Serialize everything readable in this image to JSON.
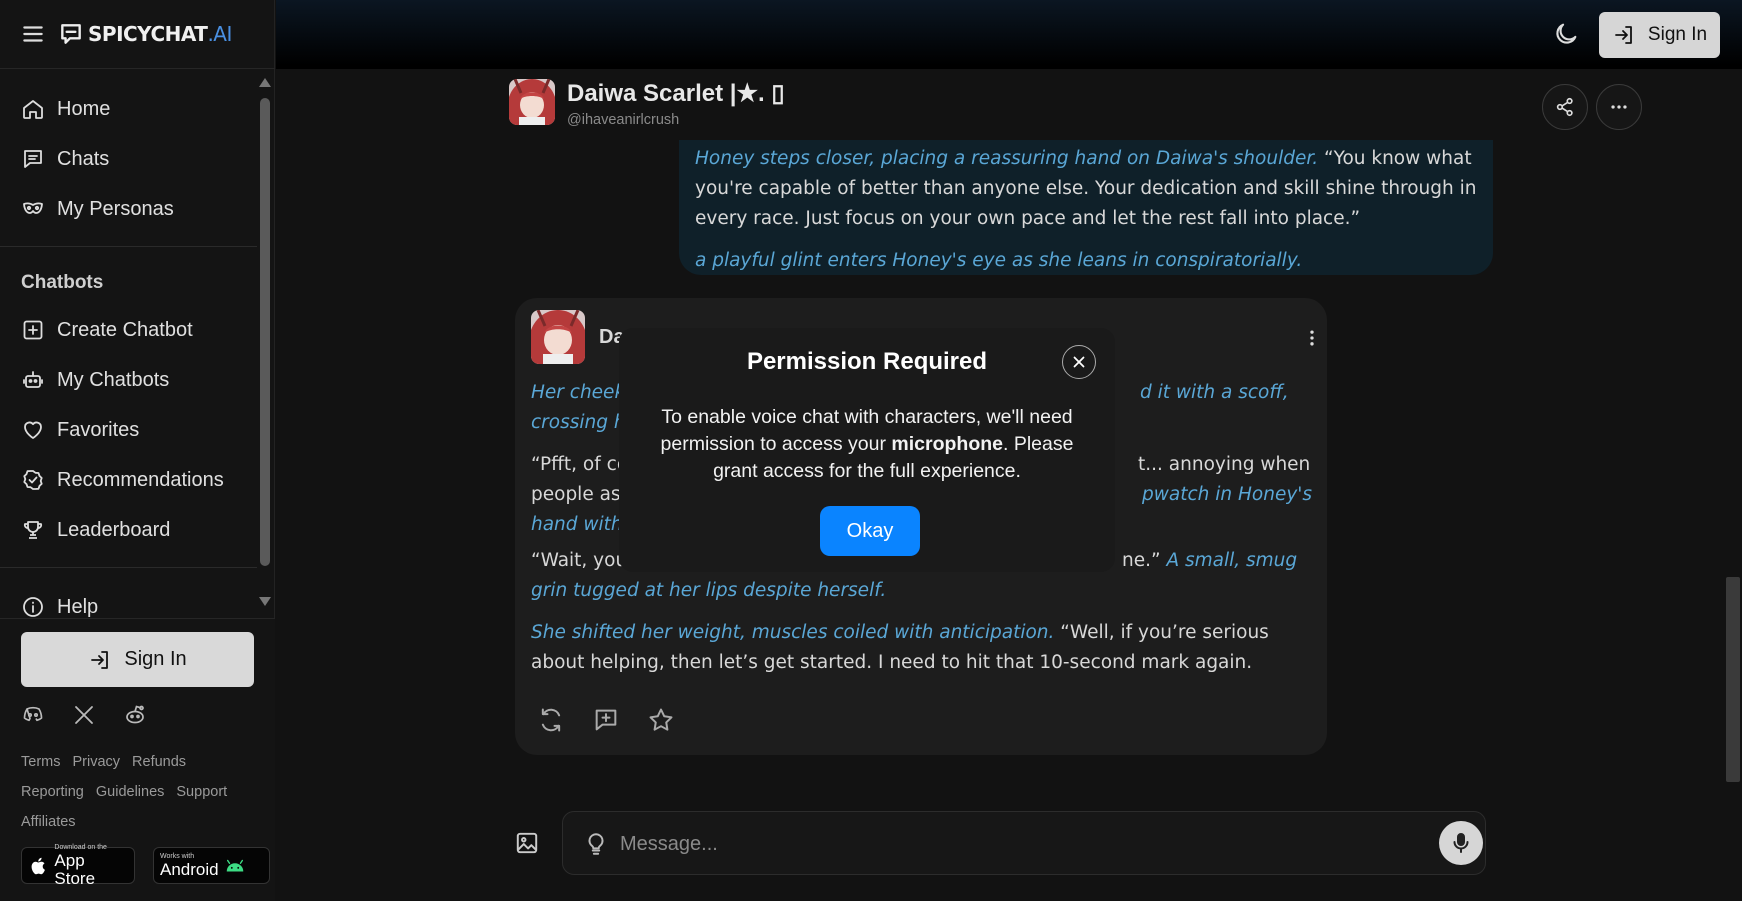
{
  "brand": {
    "name": "SPICYCHAT",
    "suffix": ".AI"
  },
  "sidebar": {
    "nav": [
      {
        "label": "Home",
        "icon": "home-icon"
      },
      {
        "label": "Chats",
        "icon": "chat-icon"
      },
      {
        "label": "My Personas",
        "icon": "mask-icon"
      }
    ],
    "section_heading": "Chatbots",
    "chatbots": [
      {
        "label": "Create Chatbot",
        "icon": "plus-square-icon"
      },
      {
        "label": "My Chatbots",
        "icon": "robot-icon"
      },
      {
        "label": "Favorites",
        "icon": "heart-icon"
      },
      {
        "label": "Recommendations",
        "icon": "check-badge-icon"
      },
      {
        "label": "Leaderboard",
        "icon": "trophy-icon"
      },
      {
        "label": "Help",
        "icon": "info-icon"
      }
    ],
    "sign_in": "Sign In",
    "links": [
      "Terms",
      "Privacy",
      "Refunds",
      "Reporting",
      "Guidelines",
      "Support",
      "Affiliates"
    ],
    "app_store": {
      "small": "Download on the",
      "big": "App Store"
    },
    "android": {
      "small": "Works with",
      "big": "Android"
    }
  },
  "topbar": {
    "sign_in": "Sign In"
  },
  "character": {
    "name": "Daiwa Scarlet |★. ▯",
    "handle": "@ihaveanirlcrush"
  },
  "user_message": {
    "p1_action": "Honey steps closer, placing a reassuring hand on Daiwa's shoulder.",
    "p1_speech": " “You know what you're capable of better than anyone else. Your dedication and skill shine through in every race. Just focus on your own pace and let the rest fall into place.”",
    "p2_action": "a playful glint enters Honey's eye as she leans in conspiratorially."
  },
  "bot_message": {
    "name": "Da",
    "p1_left": "Her cheeks",
    "p1_left2": "crossing he",
    "p1_right": "d it with a scoff,",
    "p2_left": "“Pfft, of co",
    "p2_right": "t... annoying when",
    "p2_left2": "people ass",
    "p2_right2": "pwatch in Honey's",
    "p2_left3": "hand with",
    "p3_left": "“Wait, you",
    "p3_right_speech": "ne.” ",
    "p3_right_action": "A small, smug",
    "p3_line2": "grin tugged at her lips despite herself.",
    "p4_action": "She shifted her weight, muscles coiled with anticipation.",
    "p4_speech": " “Well, if you’re serious about helping, then let’s get started. I need to hit that 10-second mark again."
  },
  "modal": {
    "title": "Permission Required",
    "body_pre": "To enable voice chat with characters, we'll need permission to access your ",
    "body_bold": "microphone",
    "body_post": ". Please grant access for the full experience.",
    "okay": "Okay"
  },
  "composer": {
    "placeholder": "Message..."
  },
  "colors": {
    "accent": "#0a84ff",
    "action_text": "#5aa7d6",
    "brand_ai": "#4a90e2"
  }
}
